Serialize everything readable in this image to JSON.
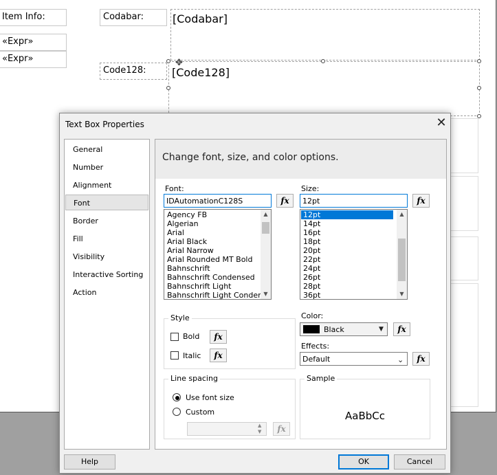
{
  "report": {
    "item_info_label": "Item Info:",
    "expr1": "«Expr»",
    "expr2": "«Expr»",
    "codabar_label": "Codabar:",
    "codabar_value": "[Codabar]",
    "code128_label": "Code128:",
    "code128_value": "[Code128]"
  },
  "dialog": {
    "title": "Text Box Properties",
    "close_glyph": "✕",
    "nav": [
      "General",
      "Number",
      "Alignment",
      "Font",
      "Border",
      "Fill",
      "Visibility",
      "Interactive Sorting",
      "Action"
    ],
    "selected_nav": "Font",
    "banner": "Change font, size, and color options.",
    "font_label": "Font:",
    "font_value": "IDAutomationC128S",
    "font_list": [
      "Agency FB",
      "Algerian",
      "Arial",
      "Arial Black",
      "Arial Narrow",
      "Arial Rounded MT Bold",
      "Bahnschrift",
      "Bahnschrift Condensed",
      "Bahnschrift Light",
      "Bahnschrift Light Condens"
    ],
    "size_label": "Size:",
    "size_value": "12pt",
    "size_list": [
      "12pt",
      "14pt",
      "16pt",
      "18pt",
      "20pt",
      "22pt",
      "24pt",
      "26pt",
      "28pt",
      "36pt"
    ],
    "selected_size": "12pt",
    "fx": "fx",
    "style_title": "Style",
    "bold_label": "Bold",
    "italic_label": "Italic",
    "color_label": "Color:",
    "color_value": "Black",
    "color_swatch": "#000000",
    "effects_label": "Effects:",
    "effects_value": "Default",
    "line_spacing_title": "Line spacing",
    "use_font_size_label": "Use font size",
    "custom_label": "Custom",
    "sample_title": "Sample",
    "sample_text": "AaBbCc",
    "help_button": "Help",
    "ok_button": "OK",
    "cancel_button": "Cancel"
  }
}
